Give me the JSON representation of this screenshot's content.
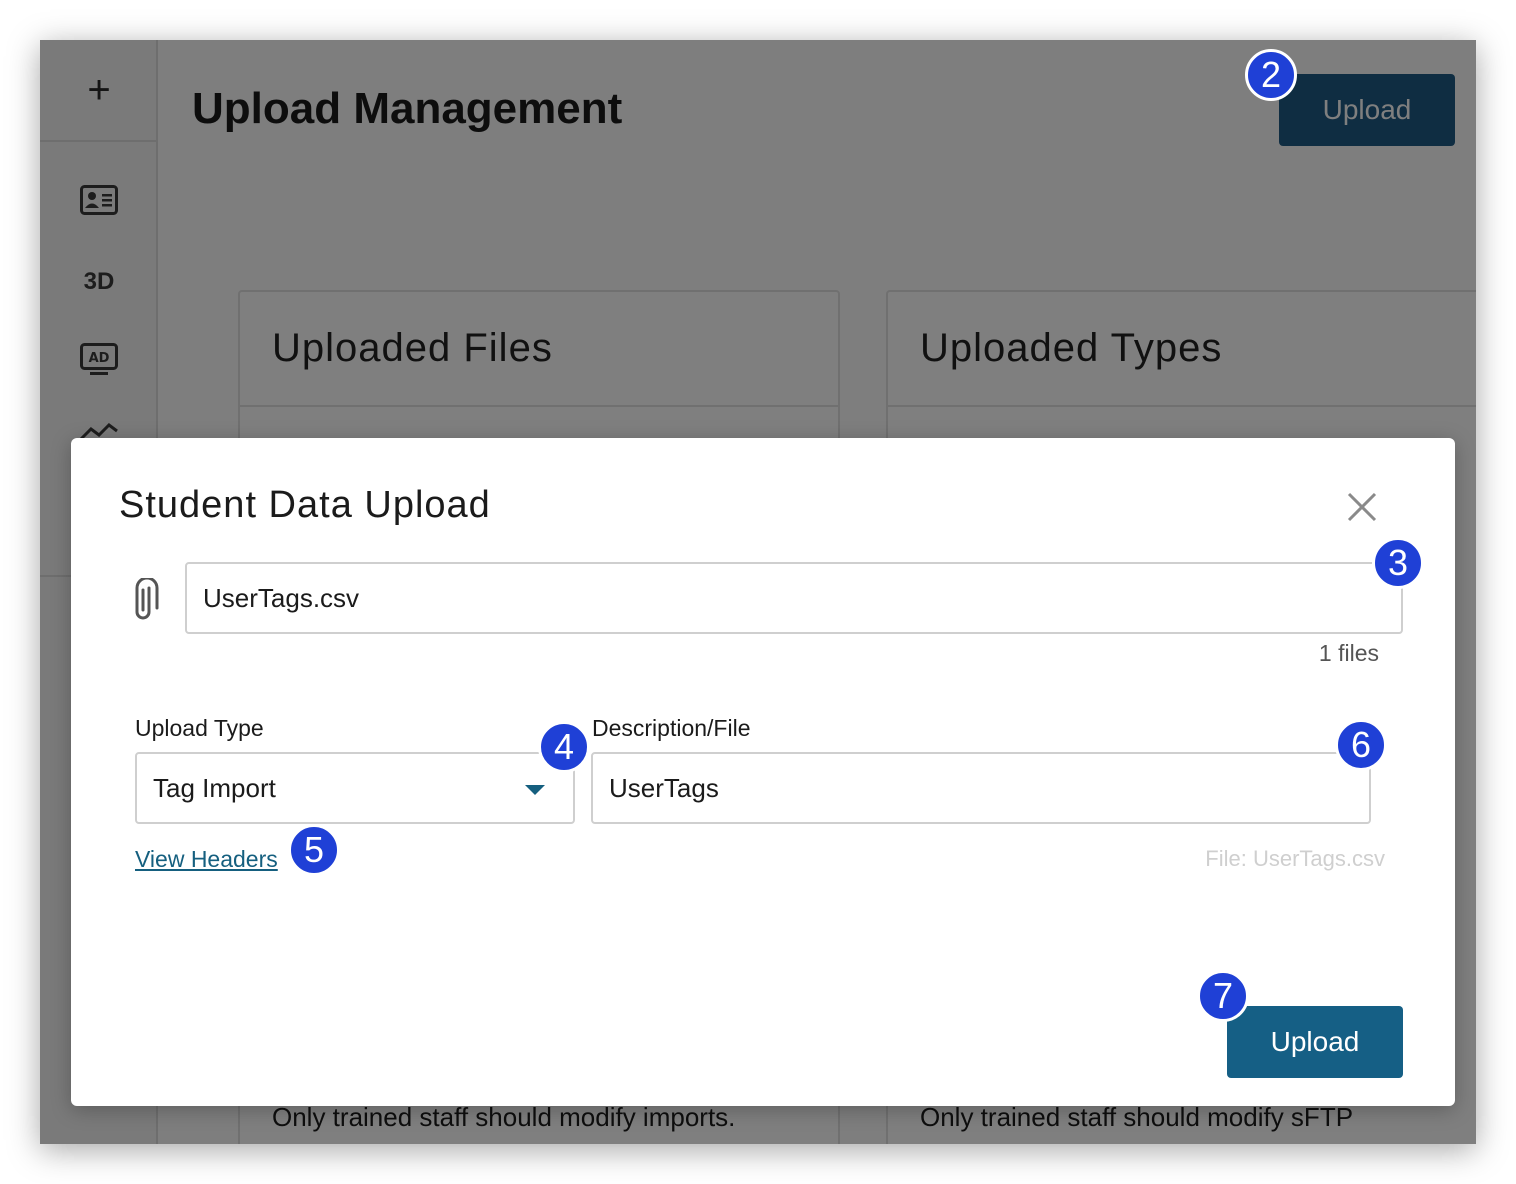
{
  "sidebar": {
    "add_icon": "plus-icon",
    "items": [
      {
        "icon": "id-card-icon"
      },
      {
        "label": "3D"
      },
      {
        "icon": "ad-display-icon"
      },
      {
        "icon": "line-chart-icon"
      }
    ]
  },
  "page": {
    "title": "Upload Management",
    "upload_label": "Upload"
  },
  "cards": [
    {
      "title": "Uploaded Files",
      "note": "Only trained staff should modify imports."
    },
    {
      "title": "Uploaded Types",
      "note": "Only trained staff should modify sFTP"
    }
  ],
  "modal": {
    "title": "Student Data Upload",
    "close_icon": "close-icon",
    "attach_icon": "paperclip-icon",
    "file_value": "UserTags.csv",
    "file_count": "1 files",
    "upload_type_label": "Upload Type",
    "upload_type_value": "Tag Import",
    "description_label": "Description/File",
    "description_value": "UserTags",
    "view_headers": "View Headers",
    "file_hint": "File: UserTags.csv",
    "upload_label": "Upload"
  },
  "callouts": [
    "2",
    "3",
    "4",
    "5",
    "6",
    "7"
  ],
  "colors": {
    "primary": "#155f85",
    "callout": "#1f40d6",
    "link": "#155f7f"
  }
}
